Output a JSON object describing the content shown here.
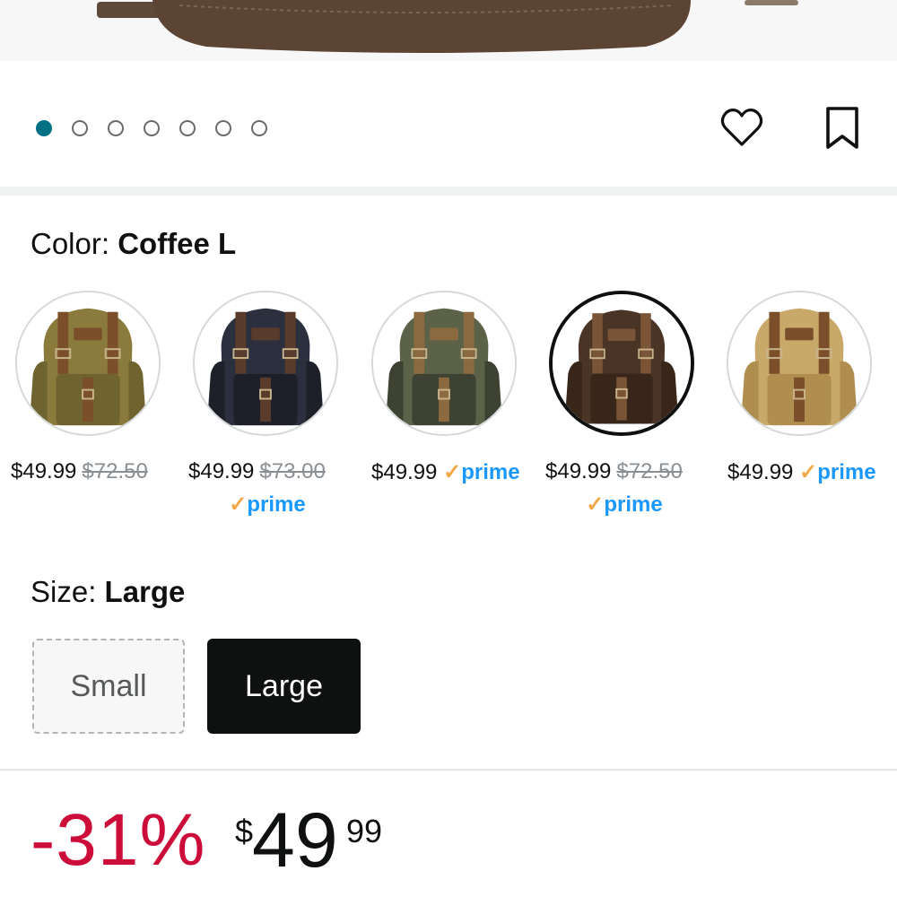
{
  "carousel": {
    "dot_count": 7,
    "active_index": 0
  },
  "actions": {
    "wishlist_icon": "heart-icon",
    "save_icon": "bookmark-icon"
  },
  "color": {
    "label": "Color: ",
    "selected": "Coffee L"
  },
  "swatches": [
    {
      "name": "army-green",
      "price": "$49.99",
      "old_price": "$72.50",
      "prime": false,
      "colors": [
        "#8a7a3c",
        "#6f6330",
        "#7b4f2a"
      ]
    },
    {
      "name": "black",
      "price": "$49.99",
      "old_price": "$73.00",
      "prime": true,
      "colors": [
        "#2c2f3d",
        "#1e2029",
        "#5a3c2c"
      ]
    },
    {
      "name": "camo",
      "price": "$49.99",
      "old_price": "",
      "prime": true,
      "colors": [
        "#5c6248",
        "#3e4232",
        "#8a6a3e"
      ]
    },
    {
      "name": "coffee",
      "price": "$49.99",
      "old_price": "$72.50",
      "prime": true,
      "colors": [
        "#4a3426",
        "#372619",
        "#7a5436"
      ],
      "selected": true
    },
    {
      "name": "khaki",
      "price": "$49.99",
      "old_price": "",
      "prime": true,
      "colors": [
        "#c8a96a",
        "#b08e50",
        "#7b4f2a"
      ]
    }
  ],
  "prime_label": "prime",
  "prime_check": "✓",
  "size": {
    "label": "Size: ",
    "selected": "Large",
    "options": [
      "Small",
      "Large"
    ]
  },
  "price": {
    "discount": "-31%",
    "currency": "$",
    "whole": "49",
    "fraction": "99"
  },
  "colors": {
    "accent": "#007185",
    "discount": "#cc0c39",
    "prime": "#1a98ff",
    "prime_check": "#f3a847"
  }
}
